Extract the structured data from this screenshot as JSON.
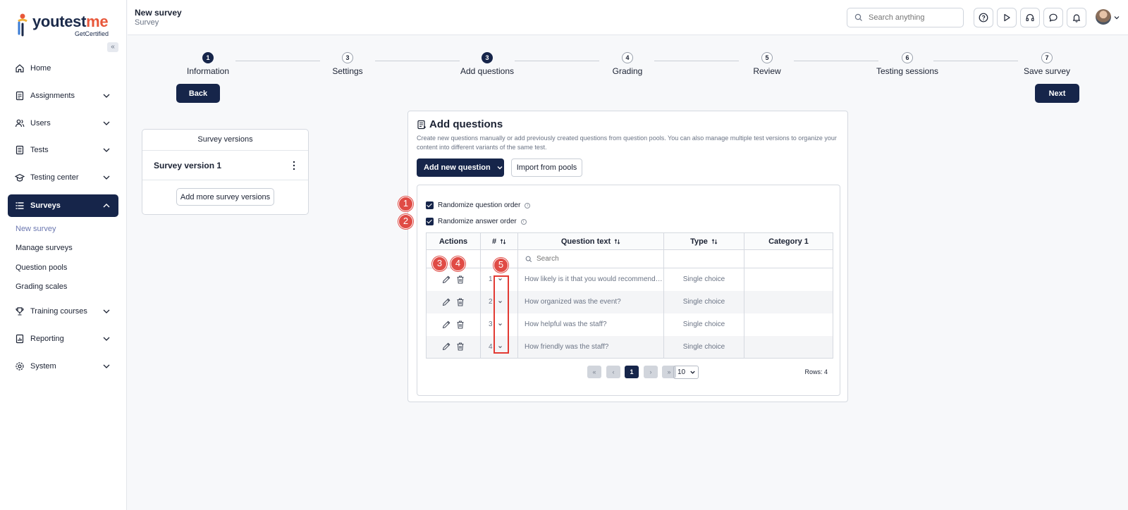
{
  "brand": {
    "name_main": "youtest",
    "name_accent": "me",
    "tagline": "GetCertified"
  },
  "sidebar": {
    "collapse_glyph": "«",
    "items": [
      {
        "label": "Home",
        "icon": "home-icon"
      },
      {
        "label": "Assignments",
        "icon": "assignment-icon"
      },
      {
        "label": "Users",
        "icon": "users-icon"
      },
      {
        "label": "Tests",
        "icon": "tests-icon"
      },
      {
        "label": "Testing center",
        "icon": "testing-center-icon"
      },
      {
        "label": "Surveys",
        "icon": "surveys-icon"
      },
      {
        "label": "Training courses",
        "icon": "trophy-icon"
      },
      {
        "label": "Reporting",
        "icon": "reporting-icon"
      },
      {
        "label": "System",
        "icon": "gear-icon"
      }
    ],
    "surveys_sub": [
      "New survey",
      "Manage surveys",
      "Question pools",
      "Grading scales"
    ]
  },
  "header": {
    "title": "New survey",
    "subtitle": "Survey",
    "search_placeholder": "Search anything"
  },
  "stepper": {
    "steps": [
      {
        "num": "1",
        "label": "Information",
        "done": true
      },
      {
        "num": "3",
        "label": "Settings",
        "done": false
      },
      {
        "num": "3",
        "label": "Add questions",
        "done": true
      },
      {
        "num": "4",
        "label": "Grading",
        "done": false
      },
      {
        "num": "5",
        "label": "Review",
        "done": false
      },
      {
        "num": "6",
        "label": "Testing sessions",
        "done": false
      },
      {
        "num": "7",
        "label": "Save survey",
        "done": false
      }
    ],
    "back_label": "Back",
    "next_label": "Next"
  },
  "versions": {
    "header": "Survey versions",
    "items": [
      "Survey version 1"
    ],
    "add_label": "Add more survey versions"
  },
  "panel": {
    "title": "Add questions",
    "description": "Create new questions manually or add previously created questions from question pools. You can also manage multiple test versions to organize your content into different variants of the same test.",
    "add_new_label": "Add new question",
    "import_label": "Import from pools",
    "randomize_question": "Randomize question order",
    "randomize_answer": "Randomize answer order"
  },
  "table": {
    "columns": [
      "Actions",
      "#",
      "Question text",
      "Type",
      "Category 1"
    ],
    "search_placeholder": "Search",
    "rows": [
      {
        "num": "1",
        "text": "How likely is it that you would recommend this event to a friend or colleague?",
        "type": "Single choice",
        "category": ""
      },
      {
        "num": "2",
        "text": "How organized was the event?",
        "type": "Single choice",
        "category": ""
      },
      {
        "num": "3",
        "text": "How helpful was the staff?",
        "type": "Single choice",
        "category": ""
      },
      {
        "num": "4",
        "text": "How friendly was the staff?",
        "type": "Single choice",
        "category": ""
      }
    ],
    "pager": {
      "first": "«",
      "prev": "‹",
      "current": "1",
      "next": "›",
      "last": "»",
      "page_size": "10",
      "rows_label": "Rows: 4"
    }
  },
  "callouts": [
    "1",
    "2",
    "3",
    "4",
    "5"
  ],
  "colors": {
    "primary": "#16254a",
    "callout": "#e04b45",
    "accent": "#e8573a"
  }
}
